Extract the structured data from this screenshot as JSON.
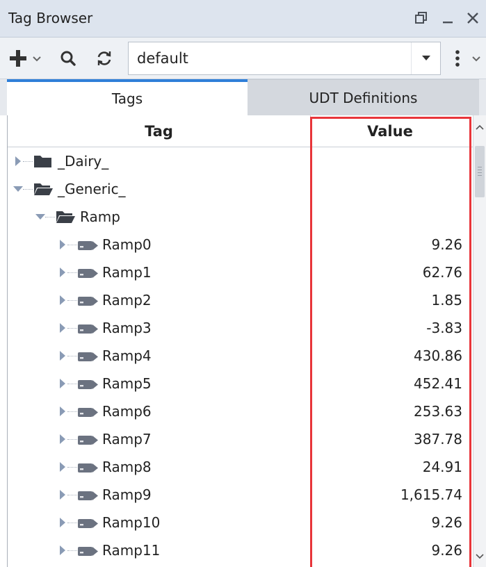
{
  "window": {
    "title": "Tag Browser",
    "restore_icon": "restore-icon",
    "minimize_icon": "minimize-icon",
    "close_icon": "close-icon"
  },
  "toolbar": {
    "add_icon": "plus-icon",
    "search_icon": "search-icon",
    "refresh_icon": "refresh-icon",
    "more_icon": "more-vertical-icon",
    "provider": {
      "value": "default",
      "dropdown_icon": "chevron-down-icon"
    }
  },
  "tabs": [
    {
      "label": "Tags",
      "active": true
    },
    {
      "label": "UDT Definitions",
      "active": false
    }
  ],
  "table": {
    "columns": [
      "Tag",
      "Value"
    ],
    "rows": [
      {
        "name": "_Dairy_",
        "value": "",
        "kind": "folder",
        "level": 0,
        "expanded": false
      },
      {
        "name": "_Generic_",
        "value": "",
        "kind": "folder-open",
        "level": 0,
        "expanded": true
      },
      {
        "name": "Ramp",
        "value": "",
        "kind": "folder-open",
        "level": 1,
        "expanded": true
      },
      {
        "name": "Ramp0",
        "value": "9.26",
        "kind": "tag",
        "level": 2,
        "expanded": false
      },
      {
        "name": "Ramp1",
        "value": "62.76",
        "kind": "tag",
        "level": 2,
        "expanded": false
      },
      {
        "name": "Ramp2",
        "value": "1.85",
        "kind": "tag",
        "level": 2,
        "expanded": false
      },
      {
        "name": "Ramp3",
        "value": "-3.83",
        "kind": "tag",
        "level": 2,
        "expanded": false
      },
      {
        "name": "Ramp4",
        "value": "430.86",
        "kind": "tag",
        "level": 2,
        "expanded": false
      },
      {
        "name": "Ramp5",
        "value": "452.41",
        "kind": "tag",
        "level": 2,
        "expanded": false
      },
      {
        "name": "Ramp6",
        "value": "253.63",
        "kind": "tag",
        "level": 2,
        "expanded": false
      },
      {
        "name": "Ramp7",
        "value": "387.78",
        "kind": "tag",
        "level": 2,
        "expanded": false
      },
      {
        "name": "Ramp8",
        "value": "24.91",
        "kind": "tag",
        "level": 2,
        "expanded": false
      },
      {
        "name": "Ramp9",
        "value": "1,615.74",
        "kind": "tag",
        "level": 2,
        "expanded": false
      },
      {
        "name": "Ramp10",
        "value": "9.26",
        "kind": "tag",
        "level": 2,
        "expanded": false
      },
      {
        "name": "Ramp11",
        "value": "9.26",
        "kind": "tag",
        "level": 2,
        "expanded": false
      }
    ]
  },
  "colors": {
    "accent": "#2f7fd8",
    "highlight": "#e8353a",
    "folder": "#3a3f47",
    "tag_icon": "#6b7280"
  }
}
